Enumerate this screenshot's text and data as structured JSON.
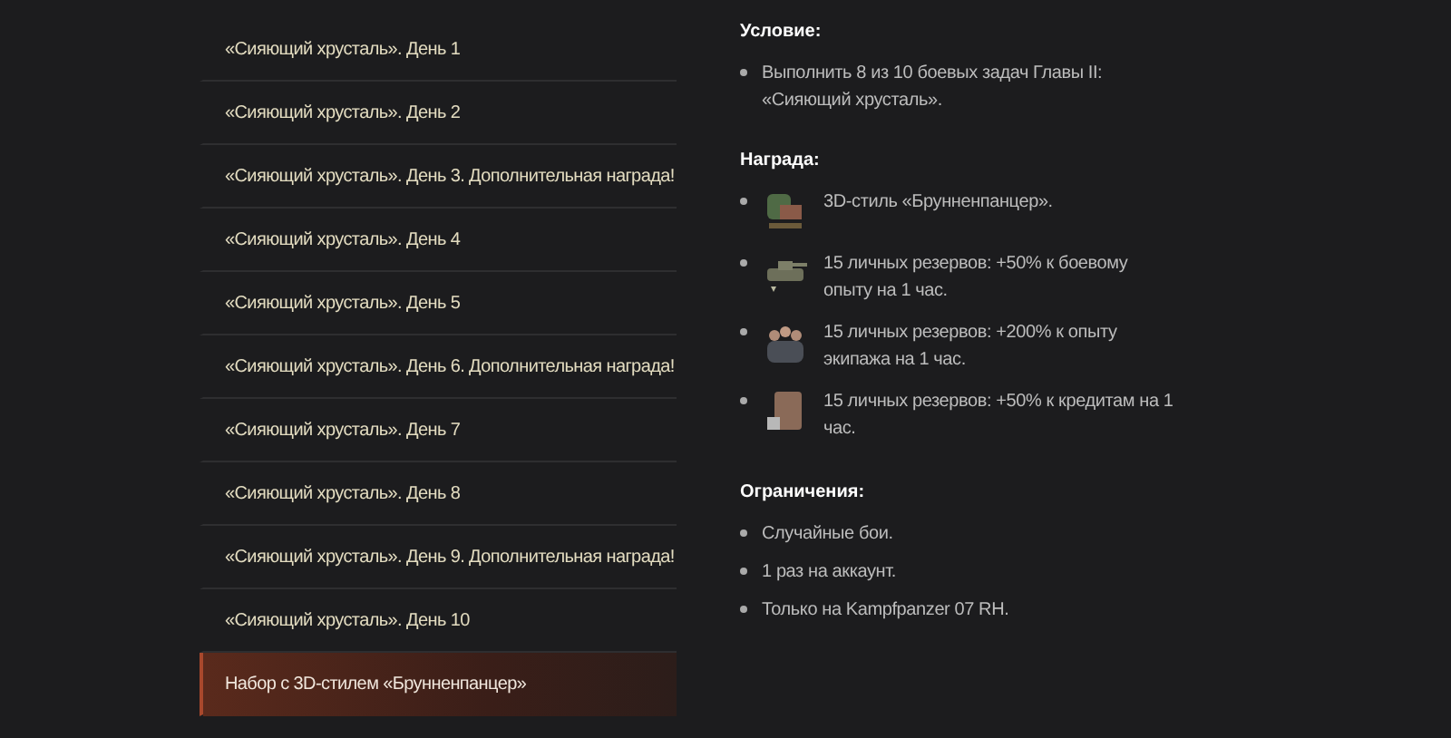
{
  "missions": [
    {
      "label": "«Сияющий хрусталь». День 1",
      "selected": false
    },
    {
      "label": "«Сияющий хрусталь». День 2",
      "selected": false
    },
    {
      "label": "«Сияющий хрусталь». День 3. Дополнительная награда!",
      "selected": false
    },
    {
      "label": "«Сияющий хрусталь». День 4",
      "selected": false
    },
    {
      "label": "«Сияющий хрусталь». День 5",
      "selected": false
    },
    {
      "label": "«Сияющий хрусталь». День 6. Дополнительная награда!",
      "selected": false
    },
    {
      "label": "«Сияющий хрусталь». День 7",
      "selected": false
    },
    {
      "label": "«Сияющий хрусталь». День 8",
      "selected": false
    },
    {
      "label": "«Сияющий хрусталь». День 9. Дополнительная награда!",
      "selected": false
    },
    {
      "label": "«Сияющий хрусталь». День 10",
      "selected": false
    },
    {
      "label": "Набор с 3D-стилем «Брунненпанцер»",
      "selected": true
    }
  ],
  "details": {
    "condition": {
      "heading": "Условие:",
      "items": [
        "Выполнить 8 из 10 боевых задач Главы II: «Сияющий хрусталь»."
      ]
    },
    "reward": {
      "heading": "Награда:",
      "items": [
        {
          "kind": "style",
          "text": "3D-стиль «Брунненпанцер»."
        },
        {
          "kind": "tank",
          "text": "15 личных резервов: +50% к боевому опыту на 1 час."
        },
        {
          "kind": "crew",
          "text": "15 личных резервов: +200% к опыту экипажа на 1 час."
        },
        {
          "kind": "credits",
          "text": "15 личных резервов: +50% к кредитам на 1 час."
        }
      ]
    },
    "restrictions": {
      "heading": "Ограничения:",
      "items": [
        "Случайные бои.",
        "1 раз на аккаунт.",
        "Только на Kampfpanzer 07 RH."
      ]
    }
  }
}
